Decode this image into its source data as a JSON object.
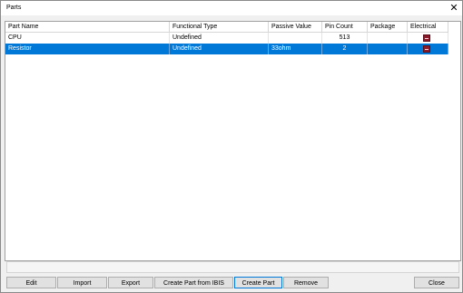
{
  "window": {
    "title": "Parts",
    "close_glyph": "✕"
  },
  "table": {
    "columns": [
      "Part Name",
      "Functional Type",
      "Passive Value",
      "Pin Count",
      "Package",
      "Electrical"
    ],
    "rows": [
      {
        "part_name": "CPU",
        "functional_type": "Undefined",
        "passive_value": "",
        "pin_count": "513",
        "package": "",
        "electrical_icon": "electrical-model-icon",
        "selected": false
      },
      {
        "part_name": "Resistor",
        "functional_type": "Undefined",
        "passive_value": "33ohm",
        "pin_count": "2",
        "package": "",
        "electrical_icon": "electrical-model-icon",
        "selected": true
      }
    ]
  },
  "buttons": {
    "edit": "Edit",
    "import": "Import",
    "export": "Export",
    "create_from_ibis": "Create Part from IBIS",
    "create_part": "Create Part",
    "remove": "Remove",
    "close": "Close"
  },
  "colors": {
    "selection": "#0078d7",
    "icon": "#8b1a2b"
  }
}
